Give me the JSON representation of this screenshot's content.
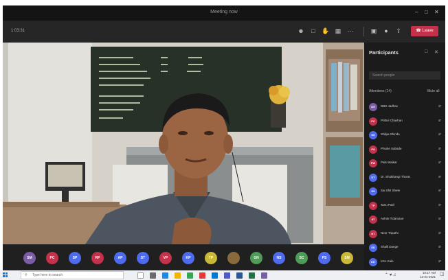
{
  "window": {
    "title": "Meeting now"
  },
  "toolbar": {
    "timer": "1:03:31",
    "leave_label": "Leave"
  },
  "participants_panel": {
    "heading": "Participants",
    "search_placeholder": "Search people",
    "section_label": "Attendees (14)",
    "mute_all_label": "Mute all",
    "people": [
      {
        "initials": "DS",
        "name": "DBS Jadhav",
        "color": "#7b5ca6"
      },
      {
        "initials": "PC",
        "name": "Prithvi Chavhan",
        "color": "#c4314b"
      },
      {
        "initials": "SS",
        "name": "Shilpa Shinde",
        "color": "#4f6bed"
      },
      {
        "initials": "PS",
        "name": "Phusle Sabade",
        "color": "#c4314b"
      },
      {
        "initials": "PW",
        "name": "Pals Waikar",
        "color": "#c4314b"
      },
      {
        "initials": "DT",
        "name": "Dr. Shubhangi Thorat",
        "color": "#4f6bed"
      },
      {
        "initials": "SS",
        "name": "Sai Shil Shete",
        "color": "#4f6bed"
      },
      {
        "initials": "TP",
        "name": "Tanu Patil",
        "color": "#c4314b"
      },
      {
        "initials": "AT",
        "name": "Ashok Tidamane",
        "color": "#c4314b"
      },
      {
        "initials": "NT",
        "name": "Neer Tripathi",
        "color": "#c4314b"
      },
      {
        "initials": "SD",
        "name": "Shaili Dange",
        "color": "#4f6bed"
      },
      {
        "initials": "KK",
        "name": "KKL Kale",
        "color": "#4f6bed"
      }
    ]
  },
  "strip": {
    "tiles": [
      {
        "initials": "SM",
        "color": "#7b5ca6"
      },
      {
        "initials": "PC",
        "color": "#c4314b"
      },
      {
        "initials": "SP",
        "color": "#4f6bed"
      },
      {
        "initials": "RP",
        "color": "#c4314b"
      },
      {
        "initials": "AP",
        "color": "#4f6bed"
      },
      {
        "initials": "ST",
        "color": "#4f6bed"
      },
      {
        "initials": "VP",
        "color": "#c4314b"
      },
      {
        "initials": "KP",
        "color": "#4f6bed"
      },
      {
        "initials": "TP",
        "color": "#c9b73a"
      },
      {
        "initials": "",
        "color": "#8a6a3c"
      },
      {
        "initials": "GN",
        "color": "#4f9b58"
      },
      {
        "initials": "NS",
        "color": "#4f6bed"
      },
      {
        "initials": "SC",
        "color": "#4f9b58"
      },
      {
        "initials": "PS",
        "color": "#4f6bed"
      },
      {
        "initials": "SM",
        "color": "#c9b73a"
      }
    ]
  },
  "taskbar": {
    "search_placeholder": "Type here to search",
    "time": "10:17 AM",
    "date": "13-04-2021"
  },
  "colors": {
    "leave": "#c4314b",
    "panel": "#1b1b1b",
    "toolbar": "#262626"
  }
}
